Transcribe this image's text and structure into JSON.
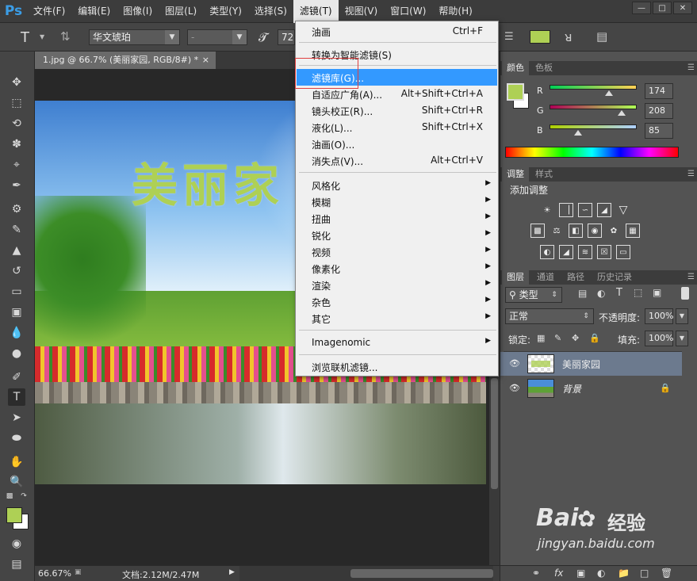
{
  "menubar": {
    "logo": "Ps",
    "items": [
      "文件(F)",
      "编辑(E)",
      "图像(I)",
      "图层(L)",
      "类型(Y)",
      "选择(S)",
      "滤镜(T)",
      "视图(V)",
      "窗口(W)",
      "帮助(H)"
    ],
    "active_index": 6
  },
  "options": {
    "font_family": "华文琥珀",
    "font_style": "-",
    "font_size": "72",
    "color": "#aed055"
  },
  "document_tab": {
    "label": "1.jpg @ 66.7% (美丽家园, RGB/8#) *"
  },
  "canvas": {
    "headline": "美丽家"
  },
  "status": {
    "zoom": "66.67%",
    "doc_size": "文档:2.12M/2.47M"
  },
  "filter_menu": {
    "items": [
      {
        "label": "油画",
        "shortcut": "Ctrl+F"
      },
      {
        "label": "转换为智能滤镜(S)",
        "shortcut": ""
      },
      {
        "label": "滤镜库(G)...",
        "shortcut": ""
      },
      {
        "label": "自适应广角(A)...",
        "shortcut": "Alt+Shift+Ctrl+A"
      },
      {
        "label": "镜头校正(R)...",
        "shortcut": "Shift+Ctrl+R"
      },
      {
        "label": "液化(L)...",
        "shortcut": "Shift+Ctrl+X"
      },
      {
        "label": "油画(O)...",
        "shortcut": ""
      },
      {
        "label": "消失点(V)...",
        "shortcut": "Alt+Ctrl+V"
      },
      {
        "label": "风格化",
        "shortcut": ""
      },
      {
        "label": "模糊",
        "shortcut": ""
      },
      {
        "label": "扭曲",
        "shortcut": ""
      },
      {
        "label": "锐化",
        "shortcut": ""
      },
      {
        "label": "视频",
        "shortcut": ""
      },
      {
        "label": "像素化",
        "shortcut": ""
      },
      {
        "label": "渲染",
        "shortcut": ""
      },
      {
        "label": "杂色",
        "shortcut": ""
      },
      {
        "label": "其它",
        "shortcut": ""
      },
      {
        "label": "Imagenomic",
        "shortcut": ""
      },
      {
        "label": "浏览联机滤镜...",
        "shortcut": ""
      }
    ],
    "highlighted_index": 2
  },
  "color_panel": {
    "tabs": [
      "颜色",
      "色板"
    ],
    "channels": [
      {
        "name": "R",
        "value": "174"
      },
      {
        "name": "G",
        "value": "208"
      },
      {
        "name": "B",
        "value": "85"
      }
    ]
  },
  "adjust_panel": {
    "tabs": [
      "调整",
      "样式"
    ],
    "title": "添加调整"
  },
  "layers_panel": {
    "tabs": [
      "图层",
      "通道",
      "路径",
      "历史记录"
    ],
    "filter_kind": "类型",
    "blend_mode": "正常",
    "opacity_label": "不透明度:",
    "opacity_value": "100%",
    "lock_label": "锁定:",
    "fill_label": "填充:",
    "fill_value": "100%",
    "layers": [
      {
        "name": "美丽家园",
        "selected": true
      },
      {
        "name": "背景",
        "selected": false
      }
    ]
  },
  "watermark": {
    "brand": "Bai",
    "brand2": "经验",
    "url": "jingyan.baidu.com"
  }
}
